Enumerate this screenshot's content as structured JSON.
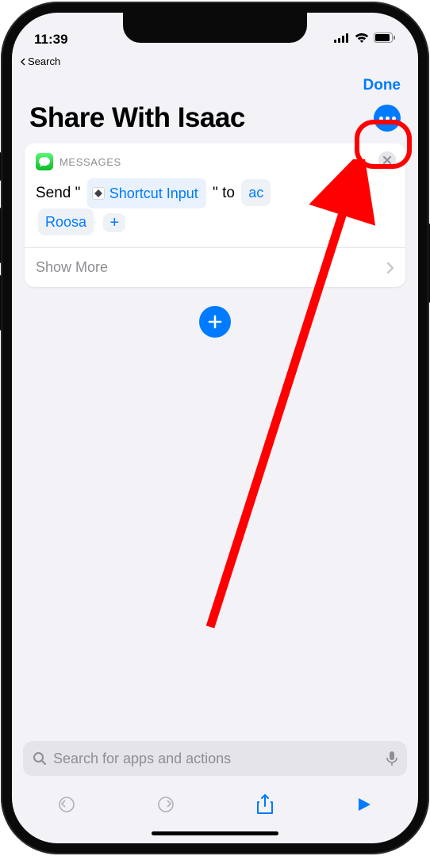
{
  "status": {
    "time": "11:39",
    "back_label": "Search"
  },
  "nav": {
    "done": "Done"
  },
  "header": {
    "title": "Share With Isaac"
  },
  "action": {
    "app": "MESSAGES",
    "send_prefix": "Send \"",
    "input_token": "Shortcut Input",
    "send_mid": "\" to",
    "recipient_partial_visible": "ac",
    "recipient_lastname": "Roosa",
    "show_more": "Show More"
  },
  "search": {
    "placeholder": "Search for apps and actions"
  }
}
